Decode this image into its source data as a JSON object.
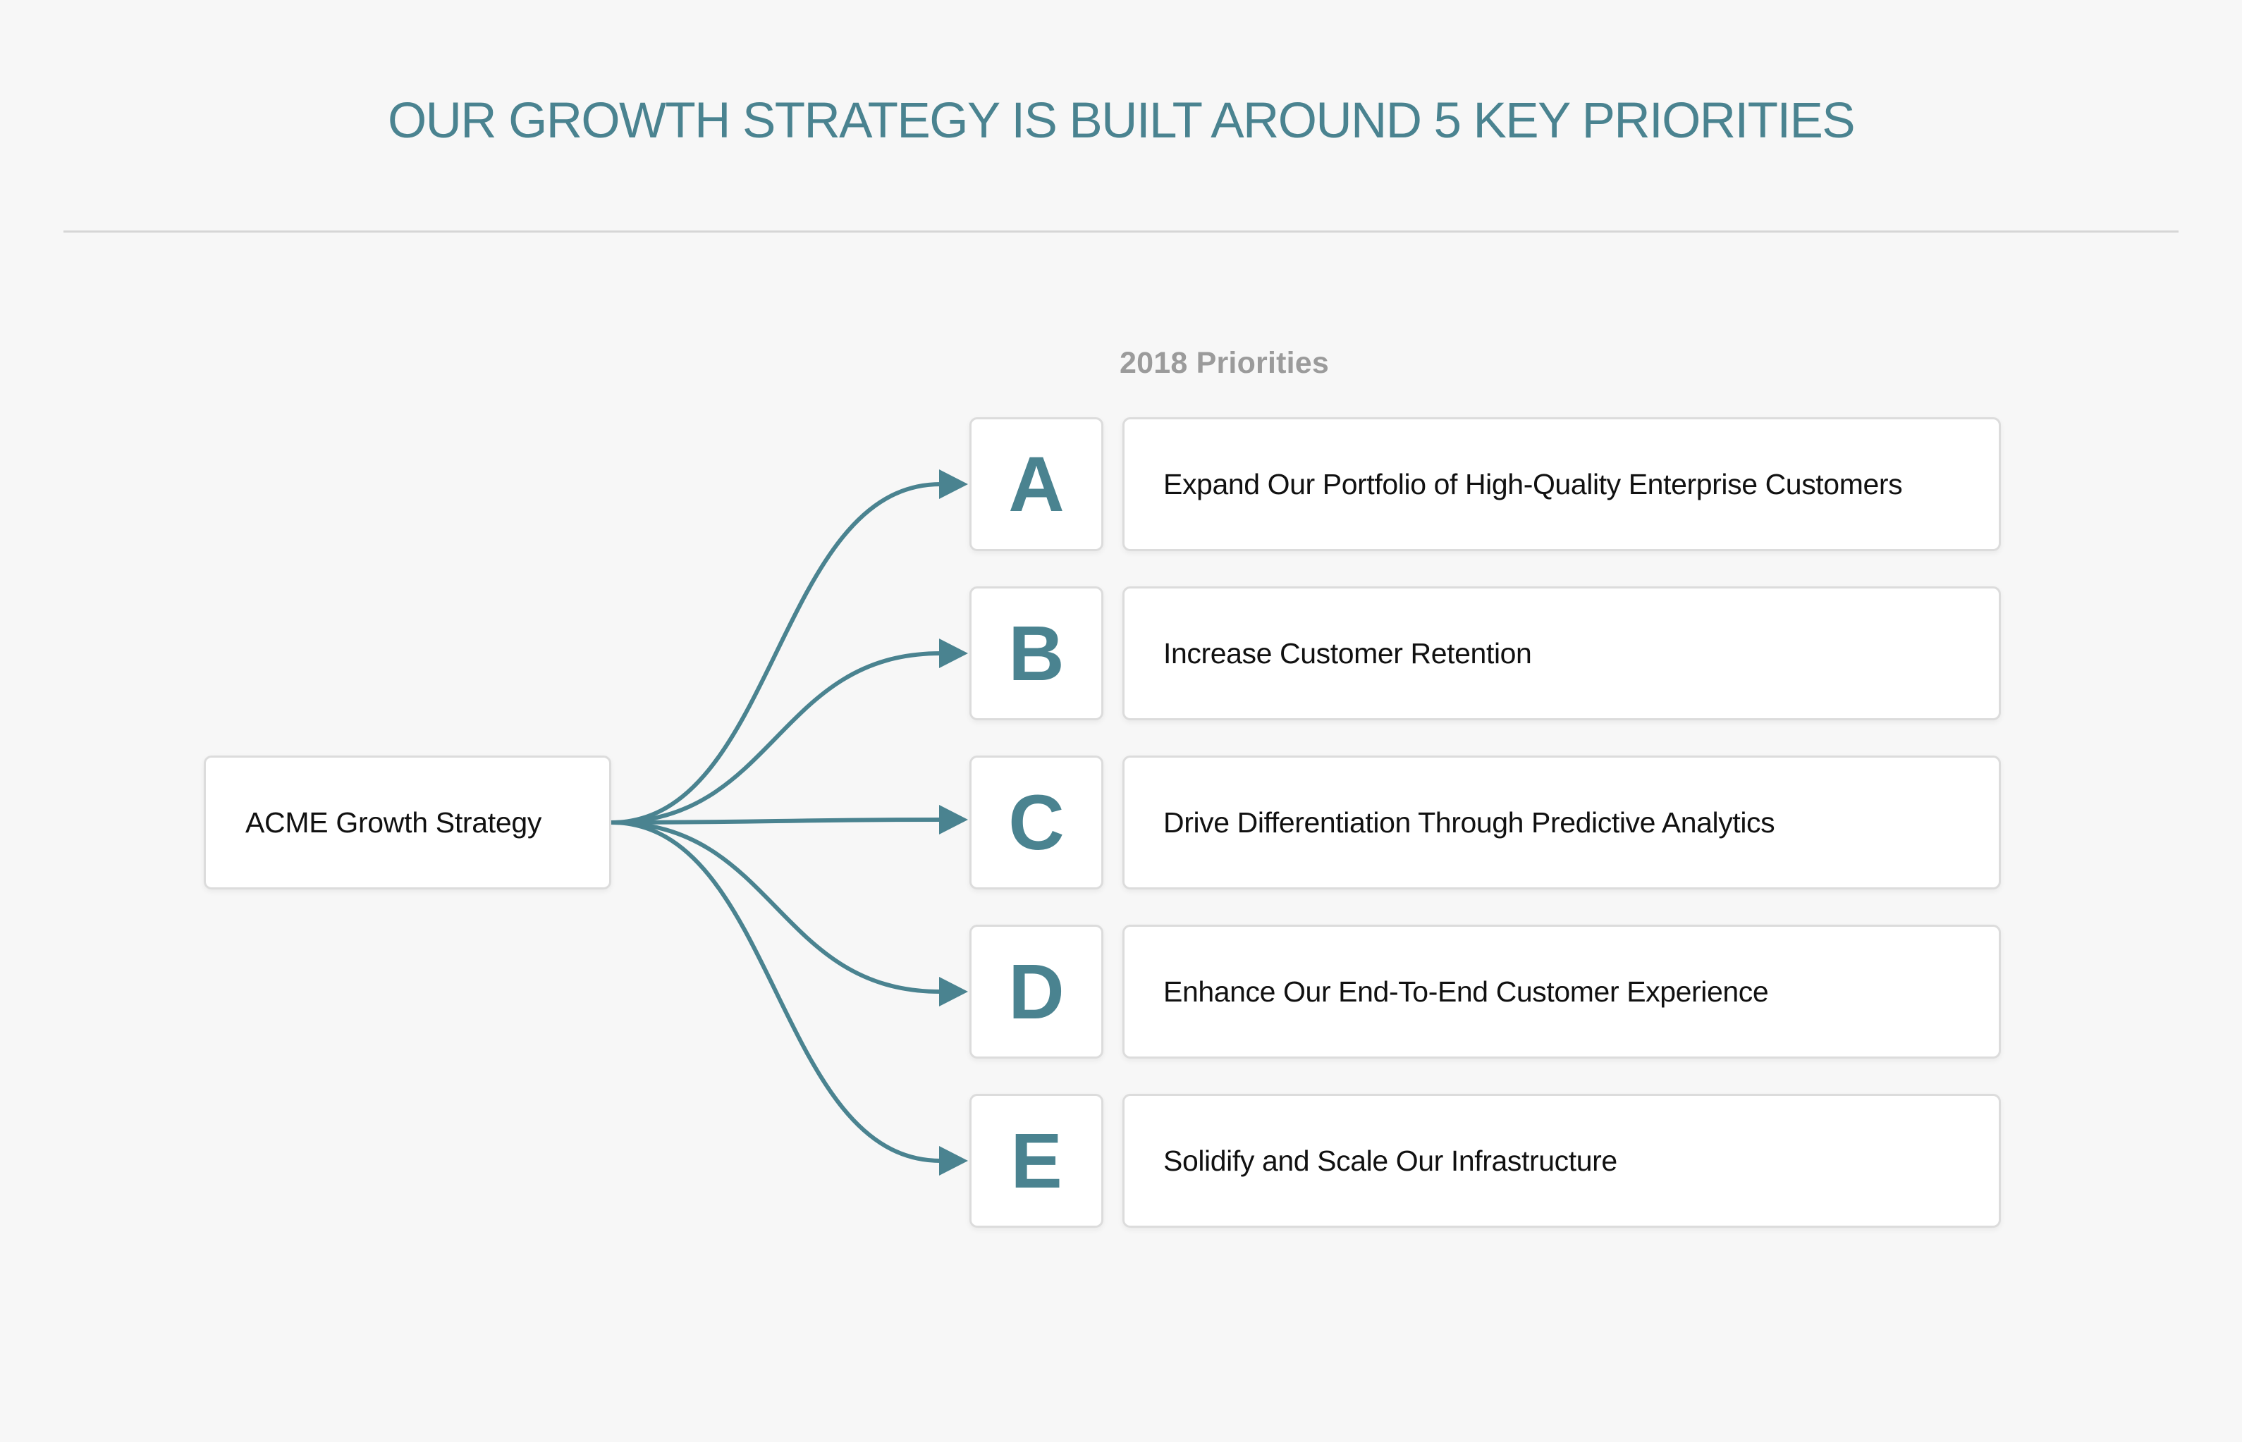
{
  "header": {
    "title": "OUR GROWTH STRATEGY IS BUILT AROUND 5 KEY PRIORITIES"
  },
  "diagram": {
    "root": {
      "label": "ACME Growth Strategy"
    },
    "section_label": "2018 Priorities",
    "priorities": [
      {
        "letter": "A",
        "text": "Expand Our Portfolio of High-Quality Enterprise Customers"
      },
      {
        "letter": "B",
        "text": "Increase Customer Retention"
      },
      {
        "letter": "C",
        "text": "Drive Differentiation Through Predictive Analytics"
      },
      {
        "letter": "D",
        "text": "Enhance Our End-To-End Customer Experience"
      },
      {
        "letter": "E",
        "text": "Solidify and Scale Our Infrastructure"
      }
    ],
    "connectors": [
      {
        "from": "root",
        "to": "A",
        "icon": "arrow-right-icon"
      },
      {
        "from": "root",
        "to": "B",
        "icon": "arrow-right-icon"
      },
      {
        "from": "root",
        "to": "C",
        "icon": "arrow-right-icon"
      },
      {
        "from": "root",
        "to": "D",
        "icon": "arrow-right-icon"
      },
      {
        "from": "root",
        "to": "E",
        "icon": "arrow-right-icon"
      }
    ]
  },
  "colors": {
    "accent": "#4a8390",
    "background": "#f7f7f7",
    "card_border": "#dcdcdc",
    "divider": "#d6d6d6",
    "section_label": "#9b9b9b",
    "text": "#111111"
  }
}
